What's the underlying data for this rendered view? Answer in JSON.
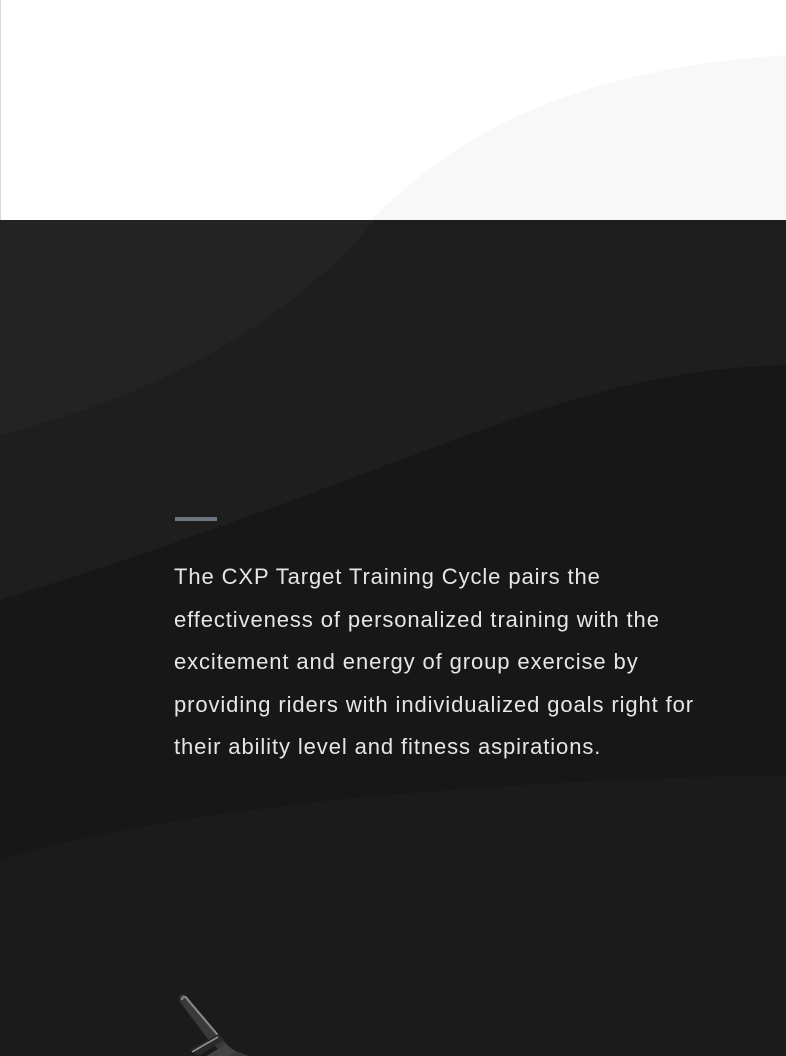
{
  "intro": {
    "text": "The CXP Target Training Cycle pairs the effectiveness of personalized training with the excitement and energy of group exercise by providing riders with individualized goals right for their ability level and fitness aspirations."
  },
  "colors": {
    "dark_background": "#1b1b1b",
    "accent_line": "#6b7680",
    "text": "#e6e6e6",
    "top_background": "#ffffff",
    "top_wave": "#f7f7f7"
  },
  "images": {
    "product": "target-training-cycle-handlebar"
  }
}
